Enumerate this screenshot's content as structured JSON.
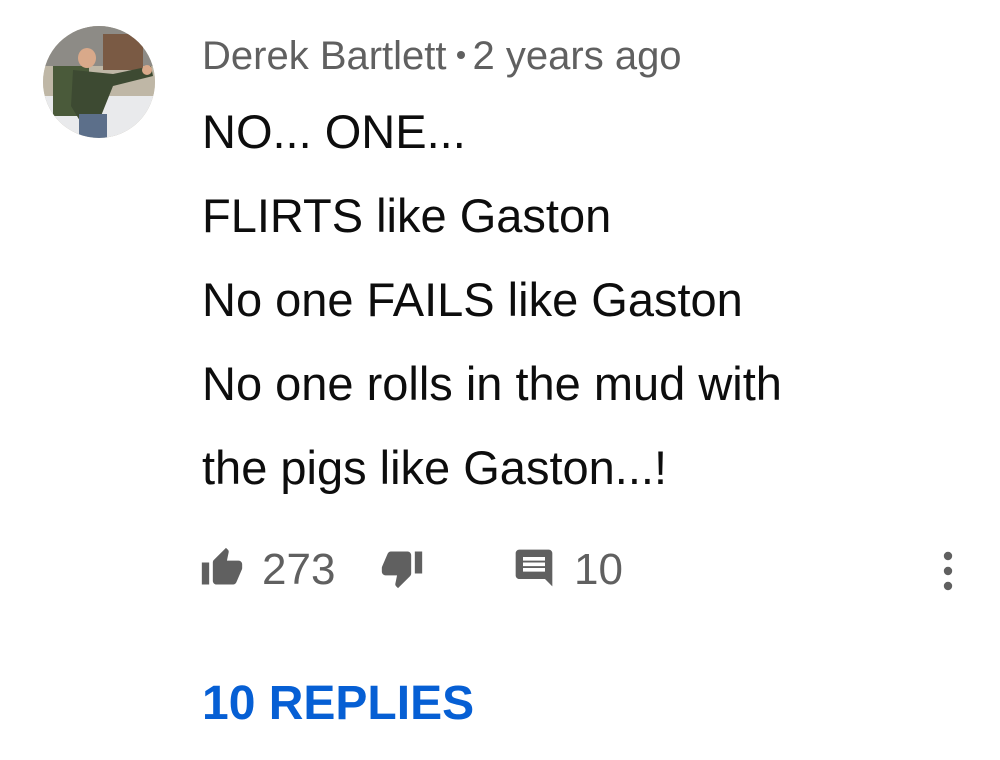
{
  "comment": {
    "author": "Derek Bartlett",
    "timestamp": "2 years ago",
    "lines": [
      "NO... ONE...",
      "FLIRTS like Gaston",
      "No one FAILS like Gaston",
      "No one rolls in the mud with",
      "the pigs like Gaston...!"
    ],
    "like_count": "273",
    "reply_count": "10",
    "replies_label": "10 REPLIES"
  },
  "icons": {
    "like": "thumbs-up-icon",
    "dislike": "thumbs-down-icon",
    "reply": "comment-icon",
    "more": "more-vert-icon"
  },
  "colors": {
    "meta_text": "#606060",
    "body_text": "#0d0d0d",
    "replies_link": "#065fd4"
  }
}
